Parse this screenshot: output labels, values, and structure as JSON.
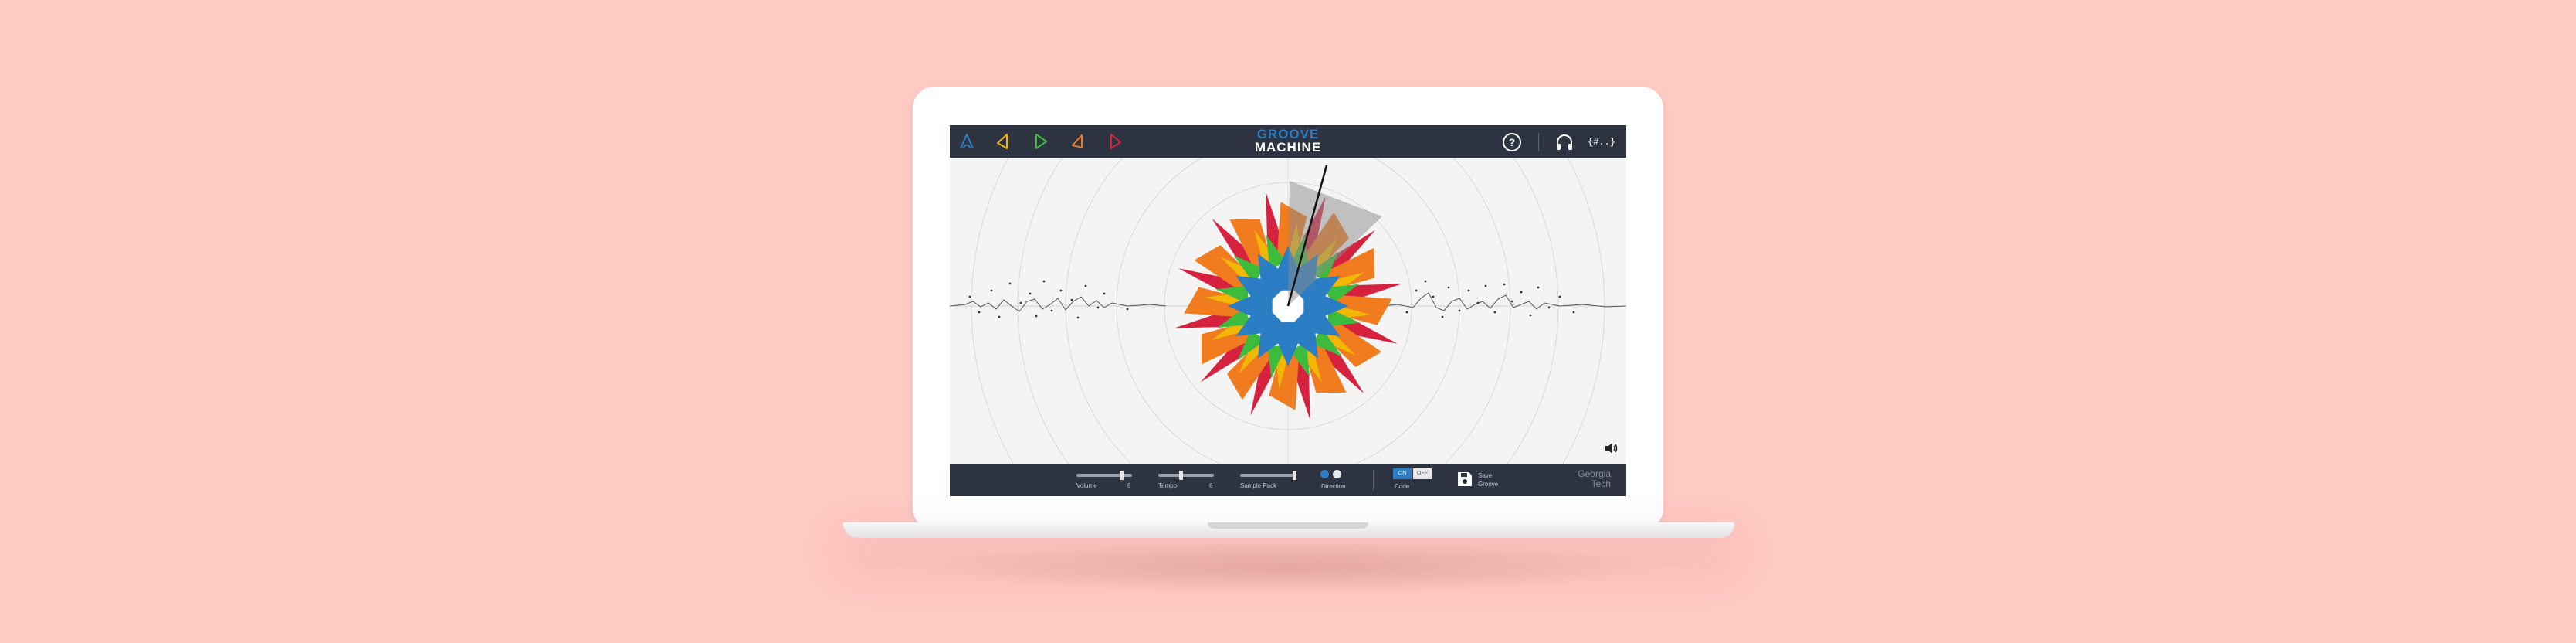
{
  "app": {
    "title_line1": "GROOVE",
    "title_line2": "MACHINE"
  },
  "toolbar": {
    "instruments": [
      {
        "icon": "blue-triangle-icon",
        "color": "#2b7ec4"
      },
      {
        "icon": "yellow-triangle-icon",
        "color": "#f2b705"
      },
      {
        "icon": "green-triangle-icon",
        "color": "#3dbb3d"
      },
      {
        "icon": "orange-triangle-icon",
        "color": "#f07c1f"
      },
      {
        "icon": "red-triangle-icon",
        "color": "#d6223f"
      }
    ],
    "help_icon": "help-icon",
    "headphones_icon": "headphones-icon",
    "code_icon_text": "{#..}"
  },
  "controls": {
    "volume_label": "Volume",
    "volume_value": "6",
    "volume_level": 0.8,
    "tempo_label": "Tempo",
    "tempo_value": "6",
    "tempo_level": 0.4,
    "sample_pack_label": "Sample Pack",
    "direction_label": "Direction",
    "code_label": "Code",
    "code_options": [
      "ON",
      "OFF"
    ],
    "save_label": "Save",
    "save_sublabel": "Groove",
    "logo_line1": "Georgia",
    "logo_line2": "Tech"
  },
  "colors": {
    "bar": "#2d3340",
    "accent": "#2b7ec4",
    "background": "#ffc9c4"
  }
}
